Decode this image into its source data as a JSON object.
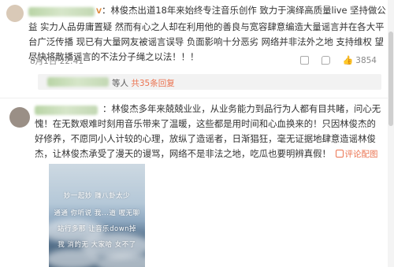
{
  "post1": {
    "verified_mark": "V",
    "colon": "：",
    "text": "林俊杰出道18年来始终专注音乐创作 致力于演绎高质量live 坚持做公益 实力人品毋庸置疑 然而有心之人却在利用他的善良与宽容肆意编造大量谣言并在各大平台广泛传播 现已有大量网友被谣言误导 负面影响十分恶劣 网络并非法外之地 支持维权 望尽快将散播谣言的不法分子绳之以法！！！",
    "time": "8月1日 22:41",
    "like_count": "3854",
    "reply_summary_prefix": "等人",
    "reply_summary_link": "共35条回复"
  },
  "post2": {
    "colon": "：",
    "text": "林俊杰多年来兢兢业业，从业务能力到品行为人都有目共睹，问心无愧！在无数艰难时刻用音乐带来了温暖，这些都是用时间和心血换来的！只因林俊杰的好修养，不愿同小人计较的心理，放纵了造谣者，日渐猖狂，毫无证据地肆意造谣林俊杰，让林俊杰承受了漫天的谩骂，网络不是非法之地，吃瓜也要明辨真假！",
    "comment_link": "评论配图"
  },
  "photo": {
    "lines": [
      "妙一起妙 赚八卦太少",
      "通通 你听说 我...道 喔无聊",
      "站行多那 让音乐down掉",
      "我 消的无 大家哈 女不了"
    ]
  }
}
